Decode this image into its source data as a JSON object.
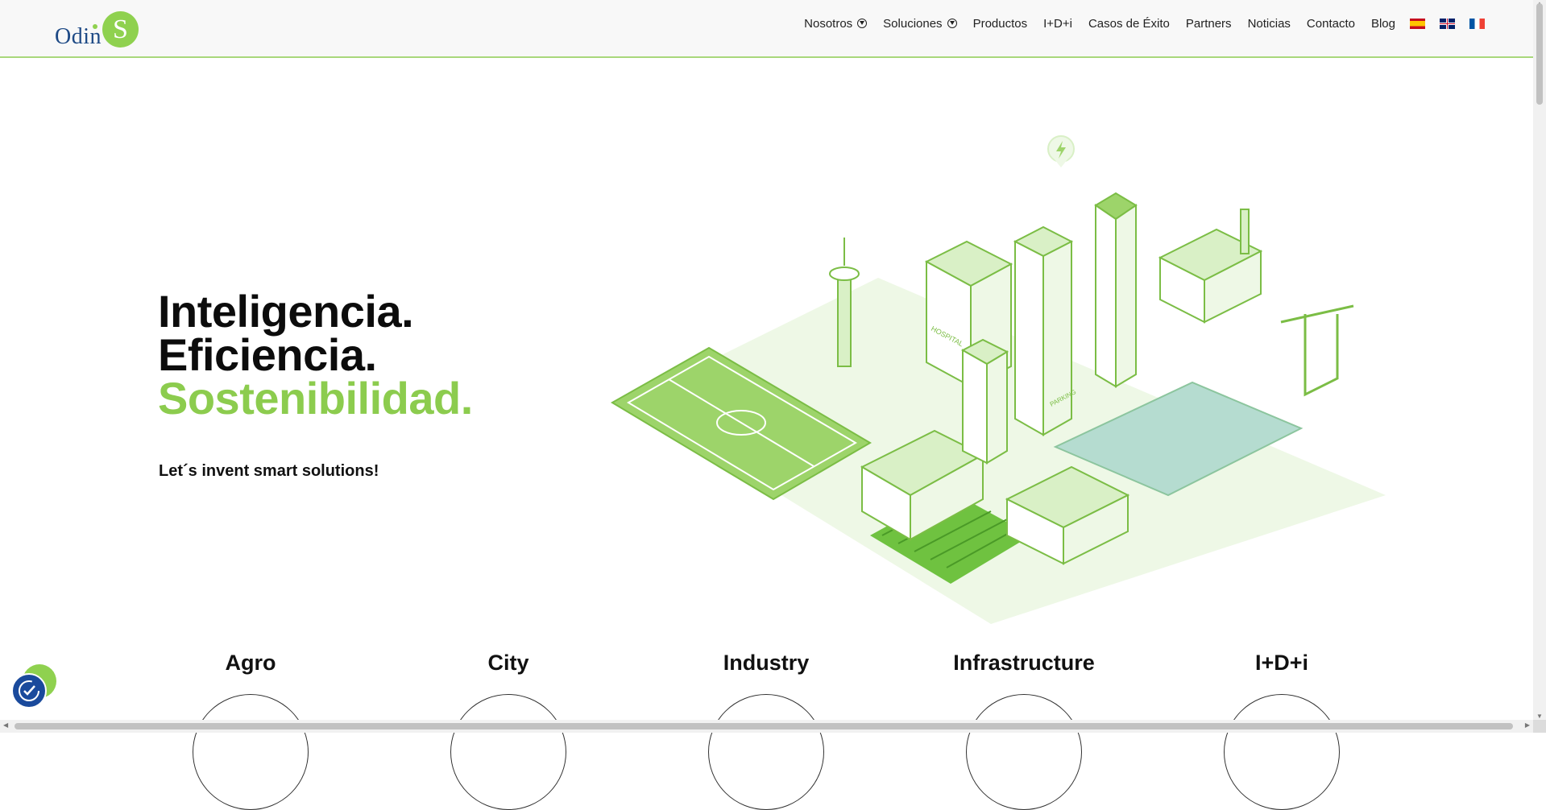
{
  "header": {
    "logo": {
      "text": "Odin",
      "mark": "S"
    },
    "nav": [
      {
        "label": "Nosotros",
        "icon": "download-circle-icon"
      },
      {
        "label": "Soluciones",
        "icon": "download-circle-icon"
      },
      {
        "label": "Productos"
      },
      {
        "label": "I+D+i"
      },
      {
        "label": "Casos de Éxito"
      },
      {
        "label": "Partners"
      },
      {
        "label": "Noticias"
      },
      {
        "label": "Contacto"
      },
      {
        "label": "Blog"
      }
    ],
    "flags": [
      "flag-es-icon",
      "flag-uk-icon",
      "flag-fr-icon"
    ]
  },
  "hero": {
    "line1": "Inteligencia.",
    "line2": "Eficiencia.",
    "line3": "Sostenibilidad.",
    "tagline": "Let´s invent smart solutions!"
  },
  "illustration": {
    "hospital": "HOSPITAL",
    "parking": "PARKING"
  },
  "categories": [
    "Agro",
    "City",
    "Industry",
    "Infrastructure",
    "I+D+i"
  ],
  "colors": {
    "accent": "#8ccc4e",
    "brand_blue": "#1e4a86",
    "widget_blue": "#1a4a9c"
  }
}
